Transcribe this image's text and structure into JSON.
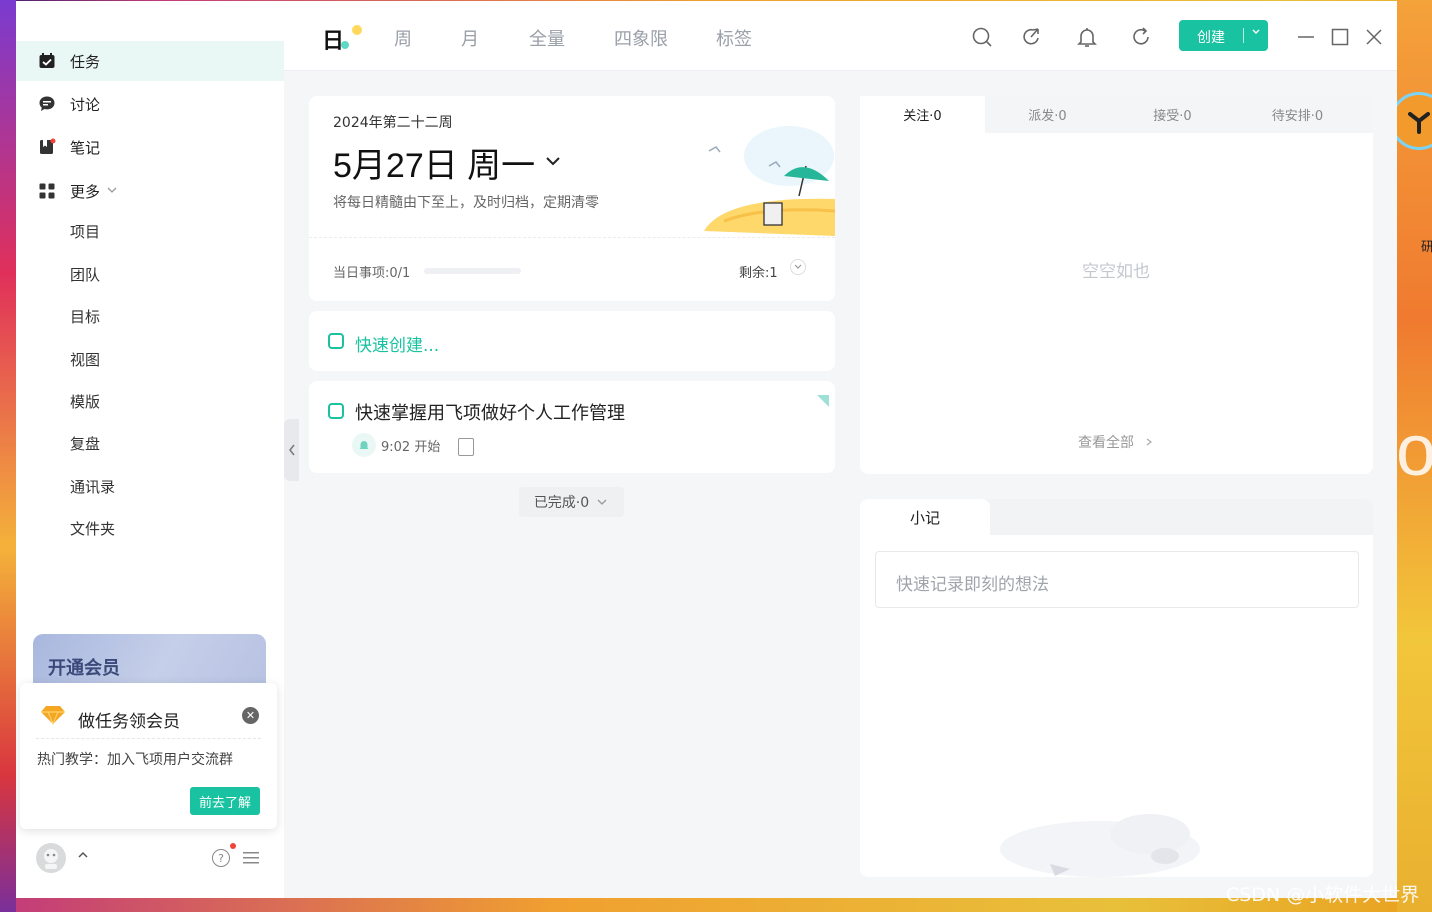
{
  "sidebar": {
    "items": [
      {
        "label": "任务",
        "icon": "calendar-check-icon"
      },
      {
        "label": "讨论",
        "icon": "chat-bubble-icon"
      },
      {
        "label": "笔记",
        "icon": "notebook-icon"
      },
      {
        "label": "更多",
        "icon": "grid-icon"
      }
    ],
    "sub_items": [
      "项目",
      "团队",
      "目标",
      "视图",
      "模版",
      "复盘",
      "通讯录",
      "文件夹"
    ],
    "vip_banner": "开通会员",
    "popup": {
      "title": "做任务领会员",
      "text": "热门教学：加入飞项用户交流群",
      "button": "前去了解"
    }
  },
  "header": {
    "tabs": [
      "日",
      "周",
      "月",
      "全量",
      "四象限",
      "标签"
    ],
    "active_tab": "日",
    "create_button": "创建"
  },
  "date_card": {
    "week": "2024年第二十二周",
    "date": "5月27日 周一",
    "subtitle": "将每日精髓由下至上，及时归档，定期清零",
    "progress_label": "当日事项:0/1",
    "progress": 0,
    "remaining_label": "剩余:1"
  },
  "quick_create": {
    "placeholder": "快速创建..."
  },
  "task": {
    "title": "快速掌握用飞项做好个人工作管理",
    "time": "9:02 开始"
  },
  "completed_label": "已完成·0",
  "follow_panel": {
    "tabs": [
      "关注·0",
      "派发·0",
      "接受·0",
      "待安排·0"
    ],
    "empty_text": "空空如也",
    "view_all": "查看全部"
  },
  "memo_panel": {
    "tab": "小记",
    "placeholder": "快速记录即刻的想法"
  },
  "watermark": "CSDN @小软件大世界",
  "colors": {
    "accent": "#19c2a0",
    "active_bg": "#e9f8f4"
  }
}
